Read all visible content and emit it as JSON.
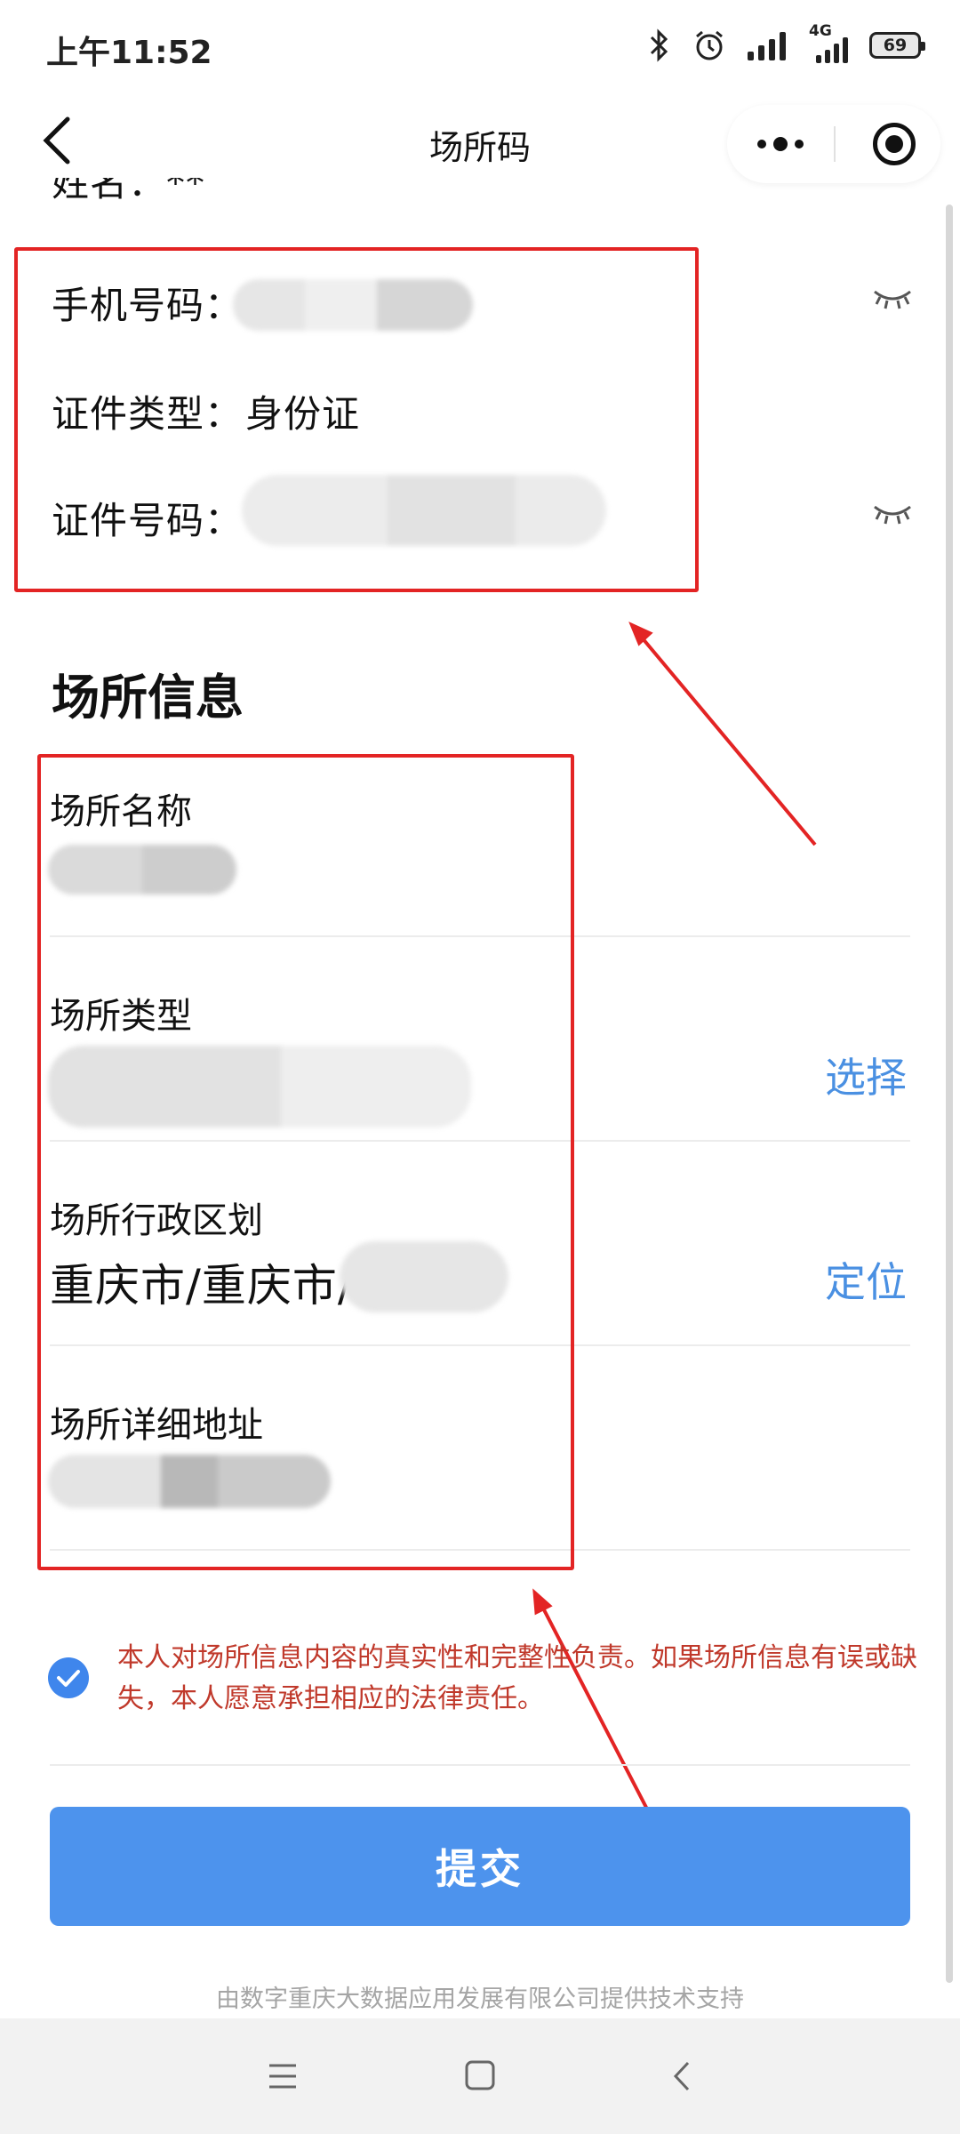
{
  "status_bar": {
    "time": "上午11:52",
    "network": "4G",
    "battery": "69"
  },
  "nav": {
    "title": "场所码"
  },
  "personal": {
    "name_partial": "姓名：**",
    "phone_label": "手机号码：",
    "id_type_label": "证件类型：",
    "id_type_value": "身份证",
    "id_number_label": "证件号码："
  },
  "venue": {
    "section_title": "场所信息",
    "name_label": "场所名称",
    "type_label": "场所类型",
    "type_action": "选择",
    "region_label": "场所行政区划",
    "region_value": "重庆市/重庆市/",
    "region_action": "定位",
    "address_label": "场所详细地址"
  },
  "agreement": {
    "text": "本人对场所信息内容的真实性和完整性负责。如果场所信息有误或缺失，本人愿意承担相应的法律责任。"
  },
  "submit_label": "提交",
  "footer_note": "由数字重庆大数据应用发展有限公司提供技术支持",
  "colors": {
    "accent": "#4d93ed",
    "link": "#4a90e2",
    "warning_text": "#c0392b",
    "annotation": "#e32424"
  }
}
